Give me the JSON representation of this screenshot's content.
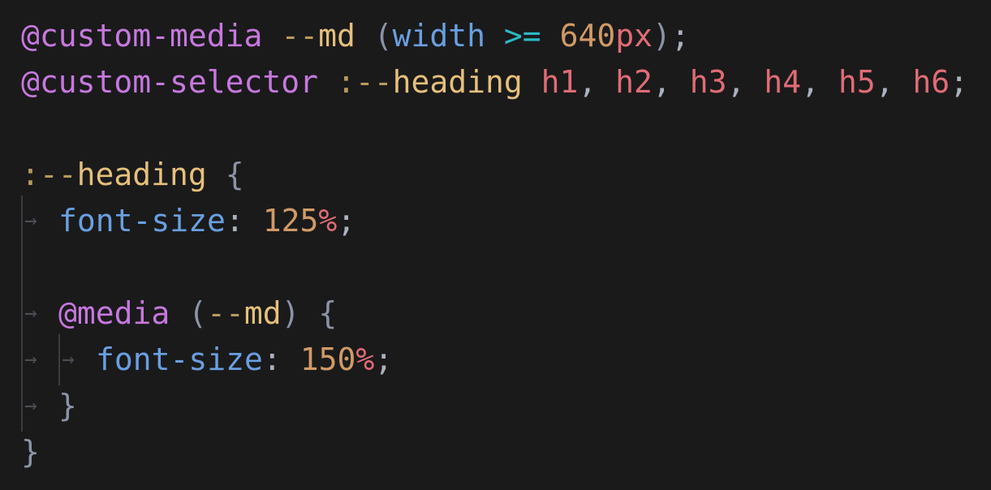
{
  "code": {
    "line1": {
      "at_rule": "@custom-media",
      "dashes": "--",
      "name": "md",
      "open_paren": "(",
      "feature": "width",
      "operator": ">=",
      "number": "640",
      "unit": "px",
      "close_paren": ")",
      "semicolon": ";"
    },
    "line2": {
      "at_rule": "@custom-selector",
      "prefix": ":--",
      "name": "heading",
      "selectors": [
        "h1",
        "h2",
        "h3",
        "h4",
        "h5",
        "h6"
      ],
      "comma": ",",
      "semicolon": ";"
    },
    "line4": {
      "prefix": ":--",
      "name": "heading",
      "open_brace": "{"
    },
    "line5": {
      "property": "font-size",
      "colon": ":",
      "number": "125",
      "unit": "%",
      "semicolon": ";"
    },
    "line7": {
      "at_rule": "@media",
      "open_paren": "(",
      "dashes": "--",
      "name": "md",
      "close_paren": ")",
      "open_brace": "{"
    },
    "line8": {
      "property": "font-size",
      "colon": ":",
      "number": "150",
      "unit": "%",
      "semicolon": ";"
    },
    "line9": {
      "close_brace": "}"
    },
    "line10": {
      "close_brace": "}"
    }
  },
  "colors": {
    "background": "#1a1a1b",
    "keyword": "#c678dd",
    "name": "#e5c07b",
    "property": "#6a9fe0",
    "operator": "#2bbac5",
    "number": "#d19a66",
    "unit_and_tag": "#e06c75",
    "indent_guide": "#3b3d42"
  },
  "icons": {
    "tab_marker": "→"
  }
}
